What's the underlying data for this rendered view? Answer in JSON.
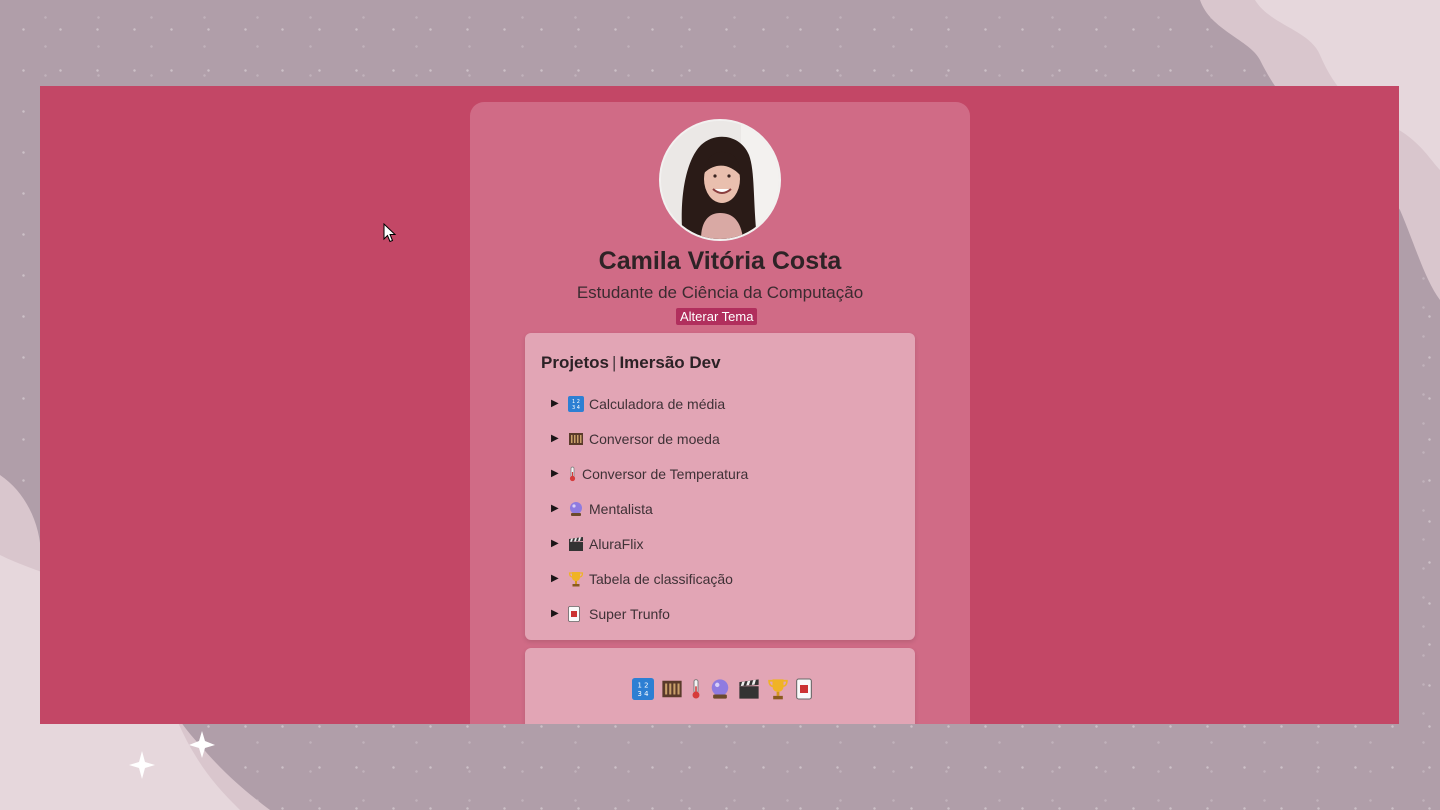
{
  "profile": {
    "name": "Camila Vitória Costa",
    "role": "Estudante de Ciência da Computação",
    "theme_button": "Alterar Tema"
  },
  "projects": {
    "title_left": "Projetos",
    "separator": "|",
    "title_right": "Imersão Dev",
    "items": [
      {
        "label": "Calculadora de média",
        "icon": "numbers-icon"
      },
      {
        "label": "Conversor de moeda",
        "icon": "abacus-icon"
      },
      {
        "label": "Conversor de Temperatura",
        "icon": "thermometer-icon"
      },
      {
        "label": "Mentalista",
        "icon": "crystal-ball-icon"
      },
      {
        "label": "AluraFlix",
        "icon": "clapper-board-icon"
      },
      {
        "label": "Tabela de classificação",
        "icon": "trophy-icon"
      },
      {
        "label": "Super Trunfo",
        "icon": "card-icon"
      }
    ]
  },
  "colors": {
    "page_bg": "#c34766",
    "card_bg": "#d06b86",
    "panel_bg": "#e2a5b5",
    "button_bg": "#b12f5d",
    "frame_bg": "#b09ea9"
  }
}
